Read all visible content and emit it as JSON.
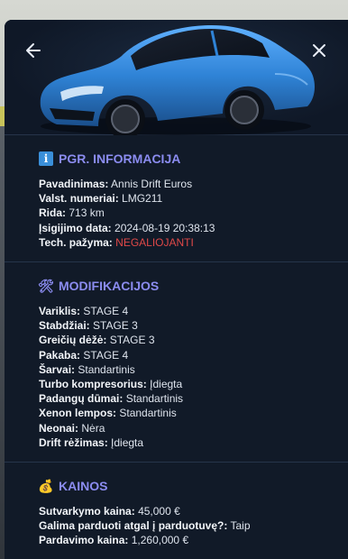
{
  "vehicle": {
    "body_color": "#2f83d6"
  },
  "nav": {
    "back_icon": "arrow-left-icon",
    "close_icon": "close-icon"
  },
  "info": {
    "title": "PGR. INFORMACIJA",
    "rows": [
      {
        "label": "Pavadinimas:",
        "value": "Annis Drift Euros"
      },
      {
        "label": "Valst. numeriai:",
        "value": "LMG211"
      },
      {
        "label": "Rida:",
        "value": "713 km"
      },
      {
        "label": "Įsigijimo data:",
        "value": "2024-08-19 20:38:13"
      },
      {
        "label": "Tech. pažyma:",
        "value": "NEGALIOJANTI",
        "status_color": "#e04848"
      }
    ]
  },
  "mods": {
    "title": "MODIFIKACIJOS",
    "rows": [
      {
        "label": "Variklis:",
        "value": "STAGE 4"
      },
      {
        "label": "Stabdžiai:",
        "value": "STAGE 3"
      },
      {
        "label": "Greičių dėžė:",
        "value": "STAGE 3"
      },
      {
        "label": "Pakaba:",
        "value": "STAGE 4"
      },
      {
        "label": "Šarvai:",
        "value": "Standartinis"
      },
      {
        "label": "Turbo kompresorius:",
        "value": "Įdiegta"
      },
      {
        "label": "Padangų dūmai:",
        "value": "Standartinis"
      },
      {
        "label": "Xenon lempos:",
        "value": "Standartinis"
      },
      {
        "label": "Neonai:",
        "value": "Nėra"
      },
      {
        "label": "Drift rėžimas:",
        "value": "Įdiegta"
      }
    ]
  },
  "prices": {
    "title": "KAINOS",
    "rows": [
      {
        "label": "Sutvarkymo kaina:",
        "value": "45,000 €"
      },
      {
        "label": "Galima parduoti atgal į parduotuvę?:",
        "value": "Taip"
      },
      {
        "label": "Pardavimo kaina:",
        "value": "1,260,000 €"
      }
    ]
  },
  "colors": {
    "accent": "#8b8cf0",
    "panel_bg": "#111a28",
    "divider": "#26344a"
  }
}
